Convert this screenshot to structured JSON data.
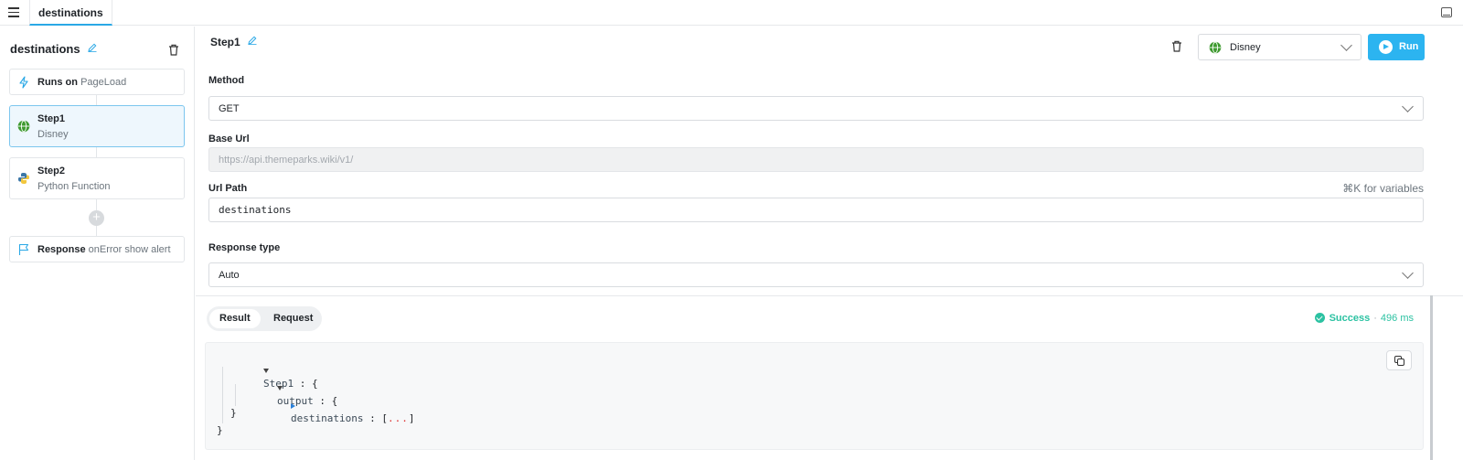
{
  "topbar": {
    "tab_label": "destinations"
  },
  "sidebar": {
    "query_name": "destinations",
    "trigger": {
      "label": "Runs on",
      "value": "PageLoad"
    },
    "steps": [
      {
        "name": "Step1",
        "subtitle": "Disney",
        "selected": true
      },
      {
        "name": "Step2",
        "subtitle": "Python Function",
        "selected": false
      }
    ],
    "response": {
      "label": "Response",
      "value": "onError show alert"
    }
  },
  "main": {
    "step_title": "Step1",
    "datasource": "Disney",
    "run_label": "Run",
    "method": {
      "label": "Method",
      "value": "GET"
    },
    "base_url": {
      "label": "Base Url",
      "value": "https://api.themeparks.wiki/v1/"
    },
    "url_path": {
      "label": "Url Path",
      "hint": "⌘K for variables",
      "value": "destinations"
    },
    "response_type": {
      "label": "Response type",
      "value": "Auto"
    }
  },
  "results": {
    "tabs": [
      "Result",
      "Request"
    ],
    "active_tab": "Result",
    "status": "Success",
    "separator": "·",
    "duration": "496 ms",
    "tree": {
      "root_key": "Step1",
      "child_key": "output",
      "leaf_key": "destinations",
      "colon": " : ",
      "open_brace": "{",
      "close_brace": "}",
      "open_bracket": "[",
      "close_bracket": "]",
      "ellipsis": "..."
    }
  },
  "colors": {
    "accent": "#2cb4f0",
    "success": "#2cc2a2",
    "selected_bg": "#eef7fd"
  }
}
